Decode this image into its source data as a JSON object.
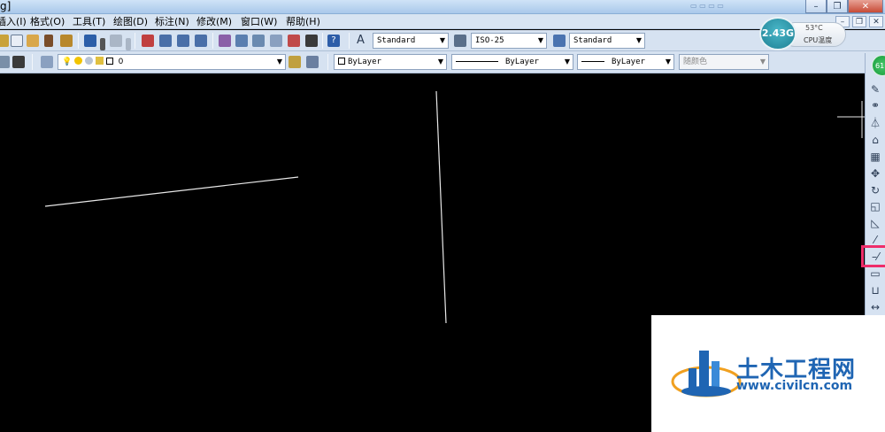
{
  "window": {
    "title_fragment": "g]",
    "buttons": {
      "minimize": "–",
      "restore": "❐",
      "close": "✕"
    }
  },
  "menu": {
    "items": [
      "插入(I)",
      "格式(O)",
      "工具(T)",
      "绘图(D)",
      "标注(N)",
      "修改(M)",
      "窗口(W)",
      "帮助(H)"
    ],
    "mdi_buttons": [
      "–",
      "❐",
      "✕"
    ]
  },
  "styles_toolbar": {
    "text_style": "Standard",
    "dim_style": "ISO-25",
    "table_style": "Standard"
  },
  "layers_toolbar": {
    "current_layer": "0",
    "color": "ByLayer",
    "linetype": "ByLayer",
    "lineweight": "ByLayer",
    "plot_style": "随颜色"
  },
  "cpu_widget": {
    "memory": "2.43G",
    "temperature": "53°C",
    "label": "CPU温度"
  },
  "badge": {
    "value": "61"
  },
  "watermark": {
    "name": "土木工程网",
    "url": "www.civilcn.com"
  },
  "colors": {
    "canvas": "#000000",
    "highlight": "#ee2d6a",
    "watermark_blue": "#1f65b3"
  }
}
